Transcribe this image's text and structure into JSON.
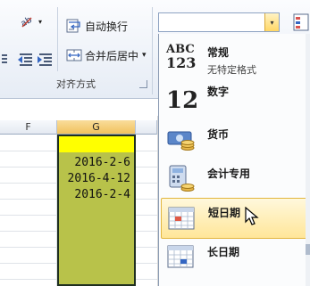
{
  "ribbon": {
    "wrap_text_label": "自动换行",
    "merge_center_label": "合并后居中",
    "merge_dropdown_arrow": "▾",
    "orientation_arrow": "▾",
    "alignment_group_label": "对齐方式"
  },
  "number_format": {
    "combo_value": "",
    "combo_arrow": "▾"
  },
  "sheet": {
    "columns": [
      "F",
      "G"
    ],
    "dates": [
      "2016-2-6",
      "2016-4-12",
      "2016-2-4"
    ],
    "highlight_color": "#ffff00",
    "selection_fill": "#b8c24a"
  },
  "format_menu": {
    "items": [
      {
        "name": "常规",
        "sub": "无特定格式",
        "icon": "abc-123-icon",
        "glyph_line1": "ABC",
        "glyph_line2": "123"
      },
      {
        "name": "数字",
        "sub": "",
        "icon": "number-12-icon",
        "glyph": "12"
      },
      {
        "name": "货币",
        "sub": "",
        "icon": "currency-icon"
      },
      {
        "name": "会计专用",
        "sub": "",
        "icon": "accounting-icon"
      },
      {
        "name": "短日期",
        "sub": "",
        "icon": "calendar-short-date-icon",
        "hovered": true
      },
      {
        "name": "长日期",
        "sub": "",
        "icon": "calendar-long-date-icon"
      }
    ]
  }
}
